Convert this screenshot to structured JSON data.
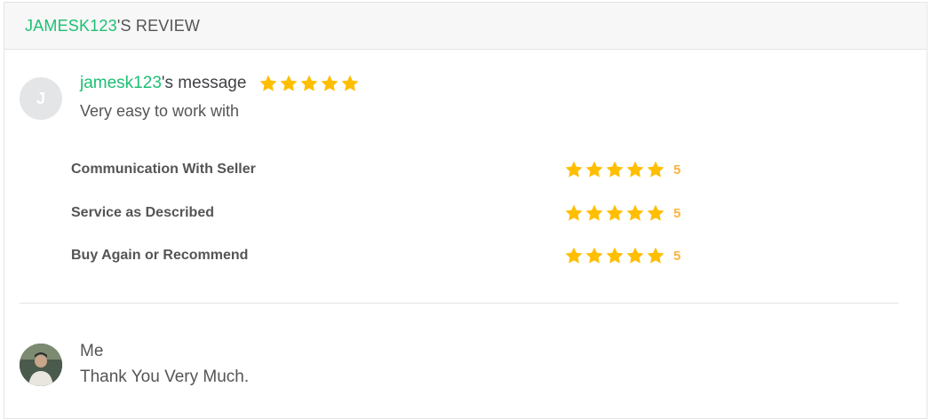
{
  "header": {
    "username": "JAMESK123",
    "suffix": "'S REVIEW"
  },
  "review": {
    "avatar_initial": "J",
    "username": "jamesk123",
    "title_suffix": "'s message",
    "rating": 5,
    "message": "Very easy to work with",
    "star_color": "#ffbe00",
    "criteria": [
      {
        "label": "Communication With Seller",
        "score": "5"
      },
      {
        "label": "Service as Described",
        "score": "5"
      },
      {
        "label": "Buy Again or Recommend",
        "score": "5"
      }
    ]
  },
  "reply": {
    "author": "Me",
    "message": "Thank You Very Much.",
    "avatar_icon": "user-photo-avatar"
  },
  "colors": {
    "accent": "#1dbf73",
    "star": "#ffbe00",
    "score": "#ffb33e"
  }
}
